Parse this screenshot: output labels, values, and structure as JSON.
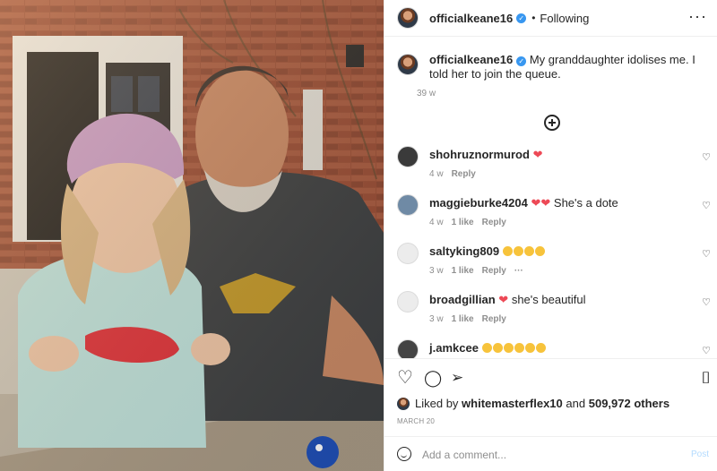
{
  "header": {
    "username": "officialkeane16",
    "verified_glyph": "✓",
    "separator": "•",
    "follow_state": "Following",
    "more_glyph": "···"
  },
  "caption": {
    "username": "officialkeane16",
    "text": "My granddaughter idolises me. I told her to join the queue.",
    "time": "39 w"
  },
  "load_more_icon": "plus-circle-icon",
  "comments": [
    {
      "username": "shohruznormurod",
      "text": "",
      "hearts": 1,
      "emojis": 0,
      "time": "4 w",
      "likes": "",
      "reply": "Reply",
      "avatar_color": "#3a3a3a"
    },
    {
      "username": "maggieburke4204",
      "text": "She's a dote",
      "hearts": 2,
      "emojis": 0,
      "time": "4 w",
      "likes": "1 like",
      "reply": "Reply",
      "avatar_color": "#6f8aa5"
    },
    {
      "username": "saltyking809",
      "text": "",
      "hearts": 0,
      "emojis": 4,
      "time": "3 w",
      "likes": "1 like",
      "reply": "Reply",
      "more": "···",
      "avatar_color": "#ececec"
    },
    {
      "username": "broadgillian",
      "text": "she's beautiful",
      "hearts": 1,
      "emojis": 0,
      "time": "3 w",
      "likes": "1 like",
      "reply": "Reply",
      "avatar_color": "#ececec"
    },
    {
      "username": "j.amkcee",
      "text": "",
      "hearts": 0,
      "emojis": 6,
      "time": "",
      "likes": "",
      "reply": "",
      "avatar_color": "#444444"
    }
  ],
  "comment_like_glyph": "♡",
  "heart_glyph": "❤",
  "actions": {
    "like_glyph": "♡",
    "comment_glyph": "◯",
    "share_glyph": "➢",
    "save_glyph": "⌷"
  },
  "likes": {
    "prefix": "Liked by",
    "user": "whitemasterflex10",
    "mid": "and",
    "count": "509,972 others"
  },
  "date": "MARCH 20",
  "add_comment": {
    "placeholder": "Add a comment...",
    "post_label": "Post"
  },
  "colors": {
    "accent": "#0095f6",
    "heart": "#ed4956",
    "verified": "#3897f0"
  }
}
